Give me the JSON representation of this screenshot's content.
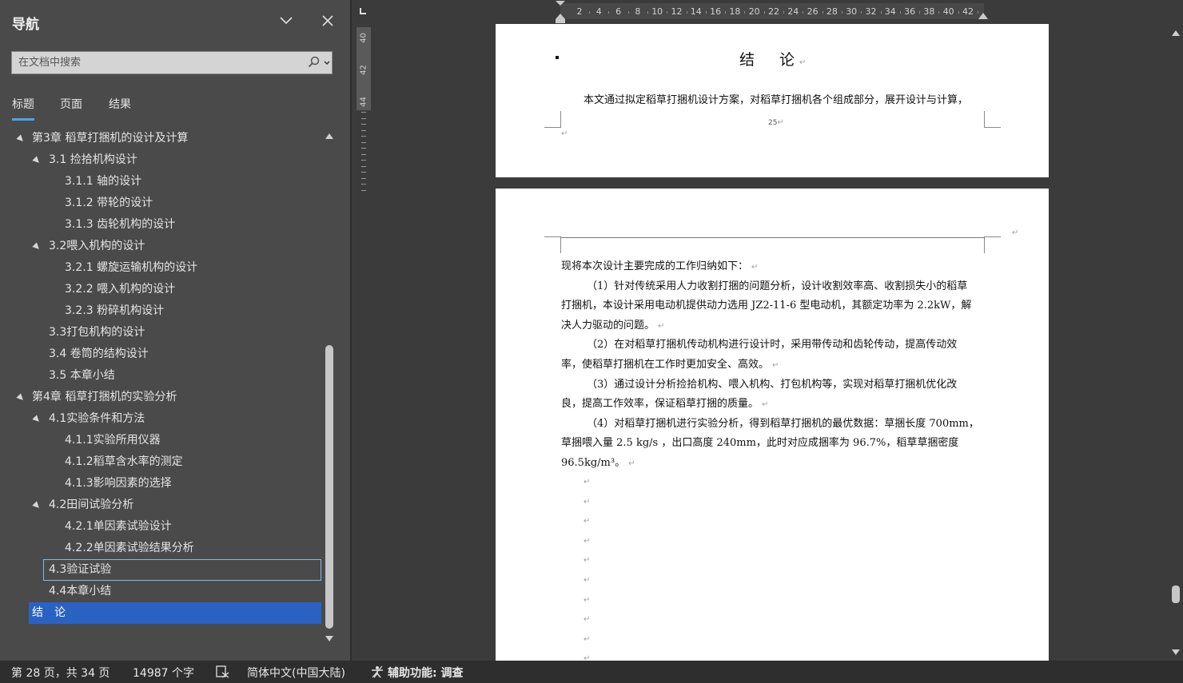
{
  "nav": {
    "title": "导航",
    "search_placeholder": "在文档中搜索",
    "tabs": [
      "标题",
      "页面",
      "结果"
    ],
    "items": [
      {
        "label": "第3章 稻草打捆机的设计及计算",
        "level": 1,
        "expanded": true
      },
      {
        "label": "3.1 捡拾机构设计",
        "level": 2,
        "expanded": true
      },
      {
        "label": "3.1.1 轴的设计",
        "level": 3
      },
      {
        "label": "3.1.2 带轮的设计",
        "level": 3
      },
      {
        "label": "3.1.3 齿轮机构的设计",
        "level": 3
      },
      {
        "label": "3.2喂入机构的设计",
        "level": 2,
        "expanded": true
      },
      {
        "label": "3.2.1 螺旋运输机构的设计",
        "level": 3
      },
      {
        "label": "3.2.2 喂入机构的设计",
        "level": 3
      },
      {
        "label": "3.2.3 粉碎机构设计",
        "level": 3
      },
      {
        "label": "3.3打包机构的设计",
        "level": 2
      },
      {
        "label": "3.4 卷筒的结构设计",
        "level": 2
      },
      {
        "label": "3.5 本章小结",
        "level": 2
      },
      {
        "label": "第4章 稻草打捆机的实验分析",
        "level": 1,
        "expanded": true
      },
      {
        "label": "4.1实验条件和方法",
        "level": 2,
        "expanded": true
      },
      {
        "label": "4.1.1实验所用仪器",
        "level": 3
      },
      {
        "label": "4.1.2稻草含水率的测定",
        "level": 3
      },
      {
        "label": "4.1.3影响因素的选择",
        "level": 3
      },
      {
        "label": "4.2田间试验分析",
        "level": 2,
        "expanded": true
      },
      {
        "label": "4.2.1单因素试验设计",
        "level": 3
      },
      {
        "label": "4.2.2单因素试验结果分析",
        "level": 3
      },
      {
        "label": "4.3验证试验",
        "level": 2,
        "state": "hover"
      },
      {
        "label": "4.4本章小结",
        "level": 2
      },
      {
        "label": "结　论",
        "level": 1,
        "state": "selected"
      }
    ]
  },
  "ruler": {
    "h_numbers": [
      "2",
      "4",
      "6",
      "8",
      "10",
      "12",
      "14",
      "16",
      "18",
      "20",
      "22",
      "24",
      "26",
      "28",
      "30",
      "32",
      "34",
      "36",
      "38",
      "40",
      "42"
    ],
    "v_numbers": [
      "40",
      "42",
      "44"
    ]
  },
  "doc": {
    "page1": {
      "title": "结　论",
      "body": "本文通过拟定稻草打捆机设计方案，对稻草打捆机各个组成部分，展开设计与计算，",
      "page_number": "25"
    },
    "page2": {
      "lines": [
        {
          "text": "现将本次设计主要完成的工作归纳如下：",
          "indent": false,
          "end": true
        },
        {
          "text": "（1）针对传统采用人力收割打捆的问题分析，设计收割效率高、收割损失小的稻草",
          "indent": true
        },
        {
          "text": "打捆机，本设计采用电动机提供动力选用 JZ2-11-6 型电动机，其额定功率为 2.2kW，解",
          "indent": false
        },
        {
          "text": "决人力驱动的问题。",
          "indent": false,
          "end": true
        },
        {
          "text": "（2）在对稻草打捆机传动机构进行设计时，采用带传动和齿轮传动，提高传动效",
          "indent": true
        },
        {
          "text": "率，使稻草打捆机在工作时更加安全、高效。",
          "indent": false,
          "end": true
        },
        {
          "text": "（3）通过设计分析捡拾机构、喂入机构、打包机构等，实现对稻草打捆机优化改",
          "indent": true
        },
        {
          "text": "良，提高工作效率，保证稻草打捆的质量。",
          "indent": false,
          "end": true
        },
        {
          "text": "（4）对稻草打捆机进行实验分析，得到稻草打捆机的最优数据：草捆长度 700mm，",
          "indent": true
        },
        {
          "text": "草捆喂入量  2.5 kg/s  ，出口高度  240mm，此时对应成捆率为  96.7%，稻草草捆密度",
          "indent": false
        },
        {
          "text": "96.5kg/m³。",
          "indent": false,
          "end": true
        }
      ],
      "paragraph_mark": "↵"
    }
  },
  "status": {
    "page": "第 28 页，共 34 页",
    "words": "14987 个字",
    "language": "简体中文(中国大陆)",
    "accessibility": "辅助功能: 调查"
  }
}
